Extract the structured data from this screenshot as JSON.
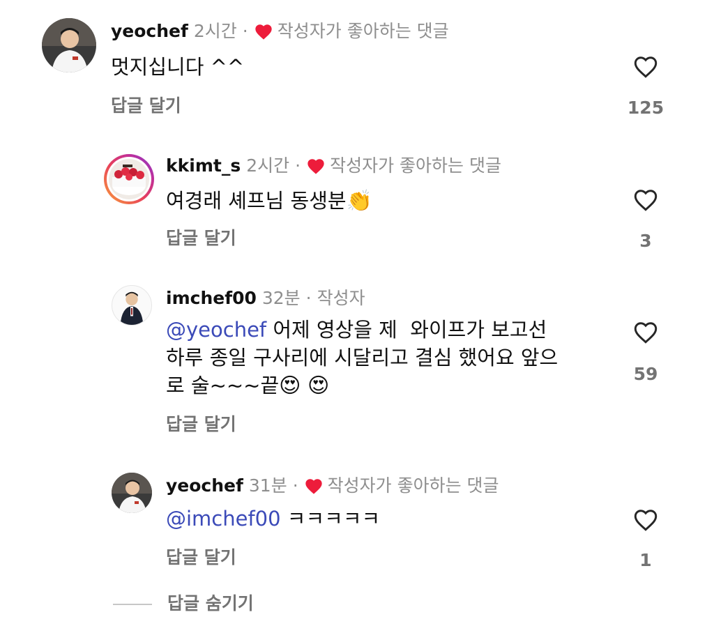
{
  "comments": [
    {
      "username": "yeochef",
      "time": "2시간",
      "separator": "·",
      "badge": "작성자가 좋아하는 댓글",
      "text": "멋지십니다 ^^",
      "reply_label": "답글 달기",
      "like_count": "125",
      "heart_icon": "heart-outline-icon"
    },
    {
      "username": "kkimt_s",
      "time": "2시간",
      "separator": "·",
      "badge": "작성자가 좋아하는 댓글",
      "text": "여경래 셰프님 동생분",
      "emoji": "👏",
      "reply_label": "답글 달기",
      "like_count": "3",
      "heart_icon": "heart-outline-icon"
    },
    {
      "username": "imchef00",
      "time": "32분",
      "separator": "·",
      "badge": "작성자",
      "mention": "@yeochef",
      "text_line1": " 어제 영상을 제  와이프가 보고선",
      "text_line2": "하루 종일 구사리에 시달리고 결심 했어요 앞으",
      "text_line3": "로 술~~~끝",
      "emoji": "😍 😍",
      "reply_label": "답글 달기",
      "like_count": "59",
      "heart_icon": "heart-outline-icon"
    },
    {
      "username": "yeochef",
      "time": "31분",
      "separator": "·",
      "badge": "작성자가 좋아하는 댓글",
      "mention": "@imchef00",
      "text": " ㅋㅋㅋㅋㅋ",
      "reply_label": "답글 달기",
      "like_count": "1",
      "heart_icon": "heart-outline-icon"
    }
  ],
  "hide_replies_label": "답글 숨기기",
  "colors": {
    "liked_heart": "#ed1c3b",
    "mention": "#3b4ab8",
    "secondary_text": "#8e8e8e"
  }
}
